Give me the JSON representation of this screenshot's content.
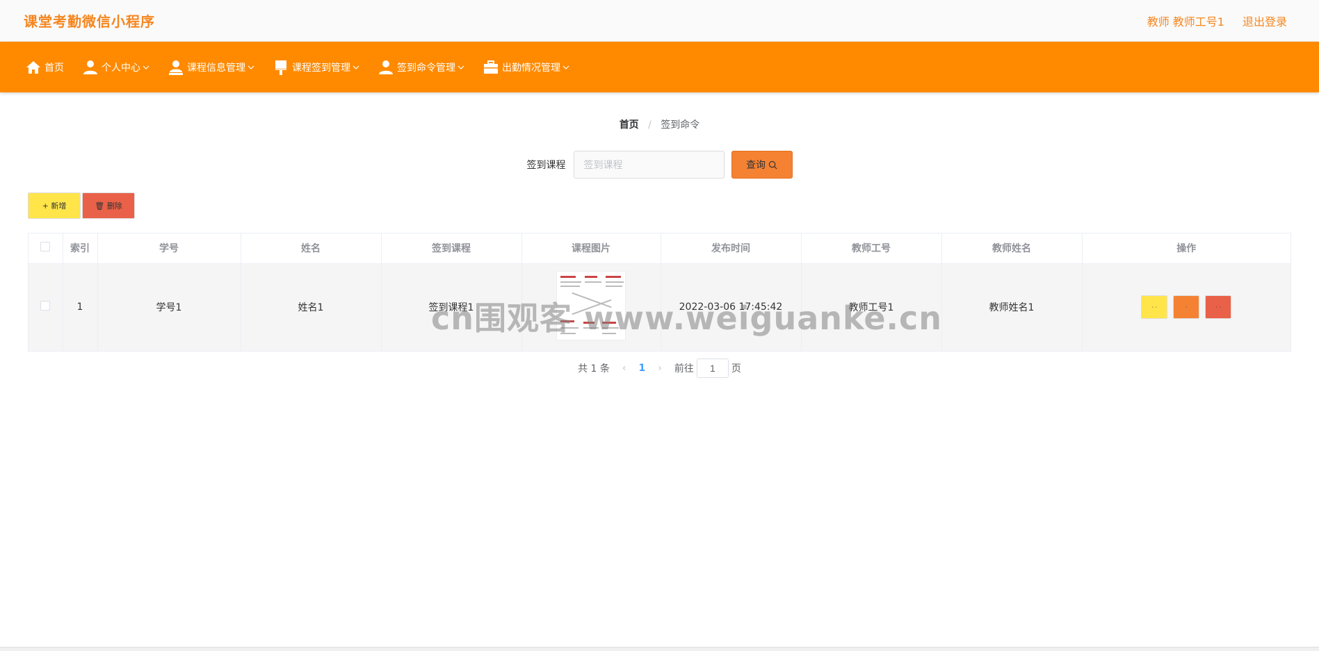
{
  "header": {
    "app_title": "课堂考勤微信小程序",
    "user_label": "教师 教师工号1",
    "logout_label": "退出登录"
  },
  "nav": {
    "items": [
      {
        "label": "首页",
        "icon": "home-icon"
      },
      {
        "label": "个人中心",
        "icon": "user-icon"
      },
      {
        "label": "课程信息管理",
        "icon": "user-stamp-icon"
      },
      {
        "label": "课程签到管理",
        "icon": "brush-icon"
      },
      {
        "label": "签到命令管理",
        "icon": "user-icon"
      },
      {
        "label": "出勤情况管理",
        "icon": "briefcase-icon"
      }
    ]
  },
  "breadcrumb": {
    "home": "首页",
    "separator": "/",
    "current": "签到命令"
  },
  "search": {
    "label": "签到课程",
    "placeholder": "签到课程",
    "value": "",
    "button_label": "查询"
  },
  "actions": {
    "add_label": "+ 新增",
    "delete_label": "🗑 删除"
  },
  "table": {
    "columns": [
      "索引",
      "学号",
      "姓名",
      "签到课程",
      "课程图片",
      "发布时间",
      "教师工号",
      "教师姓名",
      "操作"
    ],
    "rows": [
      {
        "index": "1",
        "student_no": "学号1",
        "name": "姓名1",
        "course": "签到课程1",
        "image": "course-image",
        "publish_time": "2022-03-06 17:45:42",
        "teacher_no": "教师工号1",
        "teacher_name": "教师姓名1"
      }
    ]
  },
  "pagination": {
    "total_text": "共 1 条",
    "current_page": "1",
    "goto_label": "前往",
    "goto_value": "1",
    "page_suffix": "页"
  },
  "watermark": "cn围观客 www.weiguanke.cn",
  "colors": {
    "brand_orange": "#ff8a00",
    "title_orange": "#f5861f",
    "yellow": "#ffe54a",
    "red": "#e96148"
  }
}
